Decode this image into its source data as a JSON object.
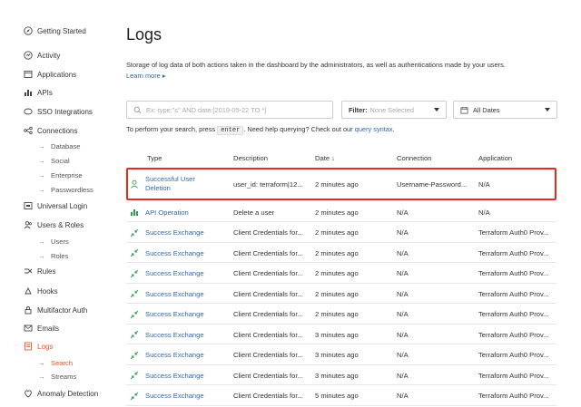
{
  "sidebar": {
    "items": [
      {
        "label": "Getting Started",
        "icon": "compass-icon"
      },
      {
        "label": "Activity",
        "icon": "activity-icon"
      },
      {
        "label": "Applications",
        "icon": "applications-icon"
      },
      {
        "label": "APIs",
        "icon": "apis-icon"
      },
      {
        "label": "SSO Integrations",
        "icon": "sso-icon"
      },
      {
        "label": "Connections",
        "icon": "connections-icon"
      },
      {
        "label": "Universal Login",
        "icon": "universal-login-icon"
      },
      {
        "label": "Users & Roles",
        "icon": "users-icon"
      },
      {
        "label": "Rules",
        "icon": "rules-icon"
      },
      {
        "label": "Hooks",
        "icon": "hooks-icon"
      },
      {
        "label": "Multifactor Auth",
        "icon": "multifactor-icon"
      },
      {
        "label": "Emails",
        "icon": "emails-icon"
      },
      {
        "label": "Logs",
        "icon": "logs-icon"
      },
      {
        "label": "Anomaly Detection",
        "icon": "anomaly-icon"
      }
    ],
    "connections_sub": [
      "Database",
      "Social",
      "Enterprise",
      "Passwordless"
    ],
    "users_sub": [
      "Users",
      "Roles"
    ],
    "logs_sub": [
      "Search",
      "Streams"
    ],
    "active_color": "#eb5424"
  },
  "main": {
    "title": "Logs",
    "description": "Storage of log data of both actions taken in the dashboard by the administrators, as well as authentications made by your users.",
    "learn_more": "Learn more ▸",
    "search_placeholder": "Ex: type:\"s\" AND date:[2019-05-22 TO *]",
    "filter_label": "Filter:",
    "filter_value": "None Selected",
    "dates_value": "All Dates",
    "hint_prefix": "To perform your search, press",
    "hint_key": "enter",
    "hint_middle": ". Need help querying? Check out our",
    "hint_link": "query syntax",
    "hint_suffix": "."
  },
  "table": {
    "headers": {
      "type": "Type",
      "description": "Description",
      "date": "Date ↓",
      "connection": "Connection",
      "application": "Application"
    },
    "rows": [
      {
        "type": "Successful User Deletion",
        "description": "user_id: terraform|12...",
        "date": "2 minutes ago",
        "connection": "Username-Password...",
        "application": "N/A",
        "icon": "user-deletion-icon"
      },
      {
        "type": "API Operation",
        "description": "Delete a user",
        "date": "2 minutes ago",
        "connection": "N/A",
        "application": "N/A",
        "icon": "api-operation-icon"
      },
      {
        "type": "Success Exchange",
        "description": "Client Credentials for...",
        "date": "2 minutes ago",
        "connection": "N/A",
        "application": "Terraform Auth0 Prov...",
        "icon": "exchange-icon"
      },
      {
        "type": "Success Exchange",
        "description": "Client Credentials for...",
        "date": "2 minutes ago",
        "connection": "N/A",
        "application": "Terraform Auth0 Prov...",
        "icon": "exchange-icon"
      },
      {
        "type": "Success Exchange",
        "description": "Client Credentials for...",
        "date": "2 minutes ago",
        "connection": "N/A",
        "application": "Terraform Auth0 Prov...",
        "icon": "exchange-icon"
      },
      {
        "type": "Success Exchange",
        "description": "Client Credentials for...",
        "date": "2 minutes ago",
        "connection": "N/A",
        "application": "Terraform Auth0 Prov...",
        "icon": "exchange-icon"
      },
      {
        "type": "Success Exchange",
        "description": "Client Credentials for...",
        "date": "2 minutes ago",
        "connection": "N/A",
        "application": "Terraform Auth0 Prov...",
        "icon": "exchange-icon"
      },
      {
        "type": "Success Exchange",
        "description": "Client Credentials for...",
        "date": "3 minutes ago",
        "connection": "N/A",
        "application": "Terraform Auth0 Prov...",
        "icon": "exchange-icon"
      },
      {
        "type": "Success Exchange",
        "description": "Client Credentials for...",
        "date": "3 minutes ago",
        "connection": "N/A",
        "application": "Terraform Auth0 Prov...",
        "icon": "exchange-icon"
      },
      {
        "type": "Success Exchange",
        "description": "Client Credentials for...",
        "date": "3 minutes ago",
        "connection": "N/A",
        "application": "Terraform Auth0 Prov...",
        "icon": "exchange-icon"
      },
      {
        "type": "Success Exchange",
        "description": "Client Credentials for...",
        "date": "5 minutes ago",
        "connection": "N/A",
        "application": "Terraform Auth0 Prov...",
        "icon": "exchange-icon"
      }
    ],
    "highlight_color": "#e8291c",
    "icon_color": "#2e9e4a"
  }
}
